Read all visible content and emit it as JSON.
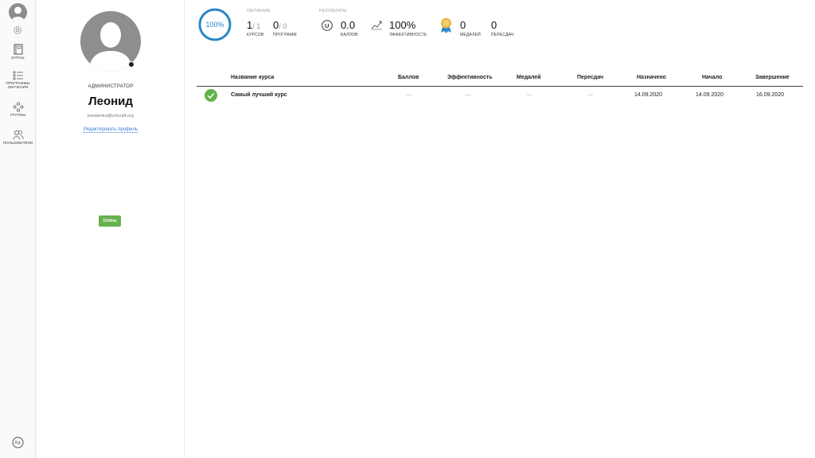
{
  "rail": {
    "items": [
      {
        "label": "Курсы",
        "icon": "book-icon"
      },
      {
        "label": "Программы обучения",
        "icon": "checklist-icon"
      },
      {
        "label": "Группы",
        "icon": "groups-icon"
      },
      {
        "label": "Пользователи",
        "icon": "users-icon"
      }
    ]
  },
  "profile": {
    "role": "АДМИНИСТРАТОР",
    "name": "Леонид",
    "email": "kovalenko@unicraft.org",
    "edit_link": "Редактировать профиль",
    "status": "Online"
  },
  "stats": {
    "progress_text": "100%",
    "progress_fraction": 1.0,
    "learning_title": "ОБУЧЕНИЕ",
    "results_title": "РЕЗУЛЬТАТЫ",
    "courses_done": "1",
    "courses_total": "/ 1",
    "courses_label": "КУРСОВ",
    "programs_done": "0",
    "programs_total": "/ 0",
    "programs_label": "ПРОГРАММ",
    "points": "0.0",
    "points_label": "БАЛЛОВ",
    "efficiency": "100%",
    "efficiency_label": "ЭФФЕКТИВНОСТЬ",
    "medals": "0",
    "medals_label": "МЕДАЛЕЙ",
    "retakes": "0",
    "retakes_label": "ПЕРЕСДАЧ"
  },
  "table": {
    "headers": {
      "course": "Название курса",
      "points": "Баллов",
      "efficiency": "Эффективность",
      "medals": "Медалей",
      "retakes": "Пересдач",
      "assigned": "Назначено",
      "start": "Начало",
      "end": "Завершение"
    },
    "rows": [
      {
        "course": "Самый лучший курс",
        "points": "—",
        "efficiency": "—",
        "medals": "—",
        "retakes": "—",
        "assigned": "14.09.2020",
        "start": "14.09.2020",
        "end": "16.09.2020"
      }
    ]
  },
  "colors": {
    "accent": "#2a88c8",
    "online": "#67b14f",
    "check": "#5fb34a",
    "link": "#3a7bd5"
  }
}
